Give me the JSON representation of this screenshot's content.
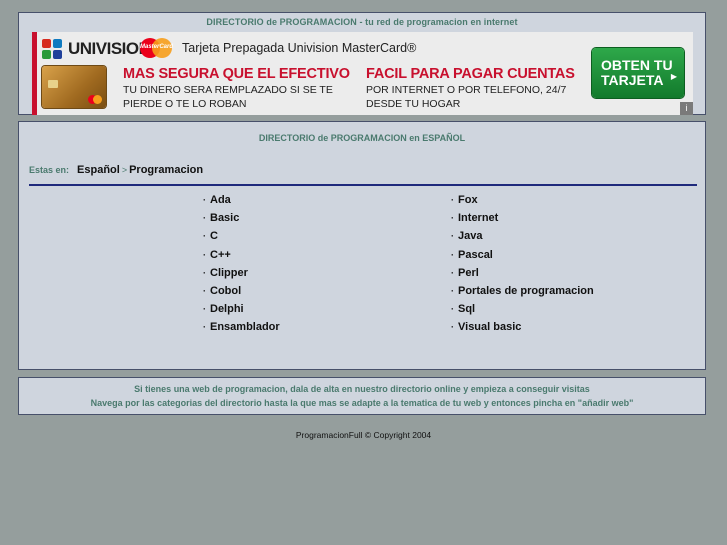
{
  "header": {
    "title": "DIRECTORIO de PROGRAMACION - tu red de programacion en internet"
  },
  "ad": {
    "brand": "UNIVISION",
    "mastercard_logo": "MasterCard",
    "headline": "Tarjeta Prepagada Univision MasterCard®",
    "col1_big": "MAS SEGURA QUE EL EFECTIVO",
    "col1_small_1": "TU DINERO SERA REMPLAZADO SI SE TE",
    "col1_small_2": "PIERDE O TE LO ROBAN",
    "col2_big": "FACIL PARA PAGAR CUENTAS",
    "col2_small_1": "POR INTERNET O POR TELEFONO, 24/7",
    "col2_small_2": "DESDE TU HOGAR",
    "cta_line1": "OBTEN TU",
    "cta_line2": "TARJETA",
    "cta_arrow": "▶",
    "info_icon": "i",
    "colors": {
      "red": "#c8102e",
      "green": "#1f9a3d"
    }
  },
  "directory": {
    "title": "DIRECTORIO de PROGRAMACION en ESPAÑOL",
    "breadcrumb_label": "Estas en:",
    "breadcrumb": [
      "Español",
      "Programacion"
    ],
    "breadcrumb_sep": ">",
    "bullet": "·",
    "col1": [
      "Ada",
      "Basic",
      "C",
      "C++",
      "Clipper",
      "Cobol",
      "Delphi",
      "Ensamblador"
    ],
    "col2": [
      "Fox",
      "Internet",
      "Java",
      "Pascal",
      "Perl",
      "Portales de programacion",
      "Sql",
      "Visual basic"
    ]
  },
  "info": {
    "line1": "Si tienes una web de programacion, dala de alta en nuestro directorio online y empieza a conseguir visitas",
    "line2": "Navega por las categorias del directorio hasta la que mas se adapte a la tematica de tu web y entonces pincha en \"añadir web\""
  },
  "footer": {
    "copyright": "ProgramacionFull © Copyright 2004"
  }
}
